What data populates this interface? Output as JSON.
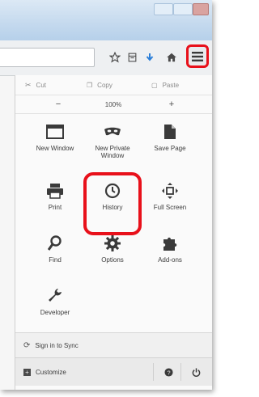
{
  "edit": {
    "cut": "Cut",
    "copy": "Copy",
    "paste": "Paste"
  },
  "zoom": {
    "minus": "−",
    "level": "100%",
    "plus": "+"
  },
  "tiles": {
    "new_window": "New Window",
    "new_private_window": "New Private\nWindow",
    "save_page": "Save Page",
    "print": "Print",
    "history": "History",
    "full_screen": "Full Screen",
    "find": "Find",
    "options": "Options",
    "addons": "Add-ons",
    "developer": "Developer"
  },
  "footer": {
    "sign_in": "Sign in to Sync",
    "customize": "Customize"
  },
  "colors": {
    "highlight": "#e8101a",
    "accent_blue": "#2a7ed8"
  },
  "icons": [
    "star-icon",
    "bookmarks-library-icon",
    "download-icon",
    "home-icon",
    "hamburger-menu-icon"
  ]
}
